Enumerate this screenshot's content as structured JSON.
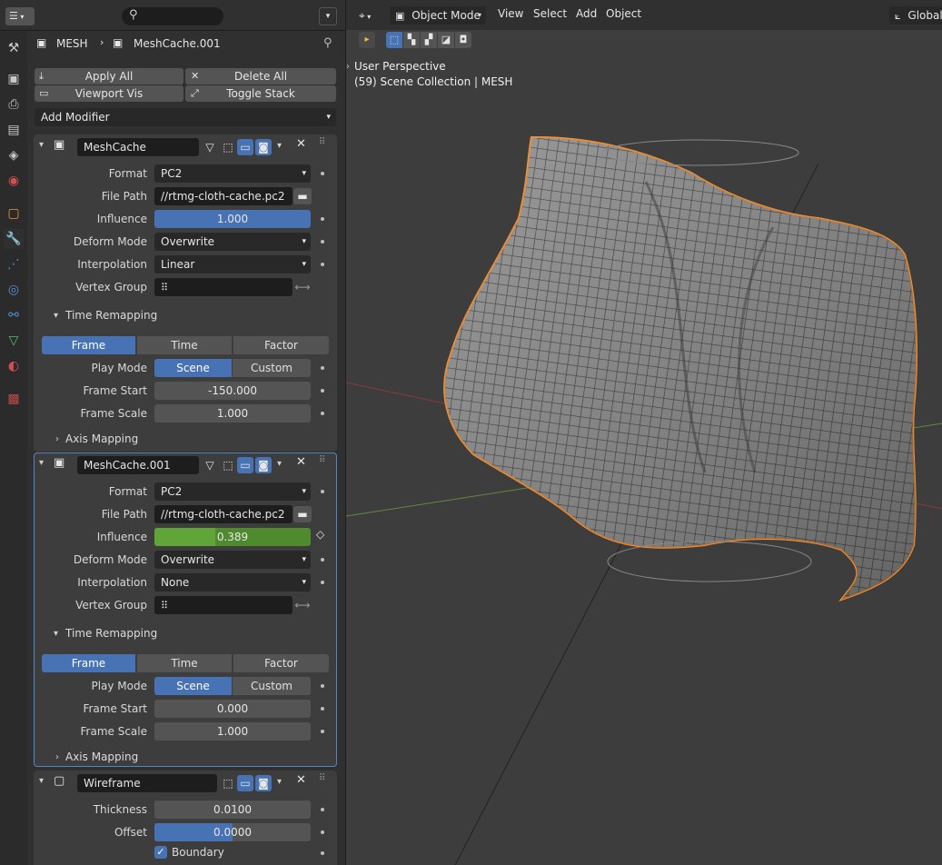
{
  "header": {
    "breadcrumb": {
      "object": "MESH",
      "modifier": "MeshCache.001"
    },
    "search_placeholder": ""
  },
  "toolbar": {
    "apply_all": "Apply All",
    "delete_all": "Delete All",
    "viewport_vis": "Viewport Vis",
    "toggle_stack": "Toggle Stack",
    "add_modifier": "Add Modifier"
  },
  "modifiers": [
    {
      "name": "MeshCache",
      "format_label": "Format",
      "format": "PC2",
      "file_path_label": "File Path",
      "file_path": "//rtmg-cloth-cache.pc2",
      "influence_label": "Influence",
      "influence": "1.000",
      "influence_value": 1.0,
      "deform_mode_label": "Deform Mode",
      "deform_mode": "Overwrite",
      "interpolation_label": "Interpolation",
      "interpolation": "Linear",
      "vertex_group_label": "Vertex Group",
      "time_remapping": "Time Remapping",
      "time_tabs": [
        "Frame",
        "Time",
        "Factor"
      ],
      "play_mode_label": "Play Mode",
      "play_modes": [
        "Scene",
        "Custom"
      ],
      "frame_start_label": "Frame Start",
      "frame_start": "-150.000",
      "frame_scale_label": "Frame Scale",
      "frame_scale": "1.000",
      "axis_mapping": "Axis Mapping"
    },
    {
      "name": "MeshCache.001",
      "format_label": "Format",
      "format": "PC2",
      "file_path_label": "File Path",
      "file_path": "//rtmg-cloth-cache.pc2",
      "influence_label": "Influence",
      "influence": "0.389",
      "influence_value": 0.389,
      "deform_mode_label": "Deform Mode",
      "deform_mode": "Overwrite",
      "interpolation_label": "Interpolation",
      "interpolation": "None",
      "vertex_group_label": "Vertex Group",
      "time_remapping": "Time Remapping",
      "time_tabs": [
        "Frame",
        "Time",
        "Factor"
      ],
      "play_mode_label": "Play Mode",
      "play_modes": [
        "Scene",
        "Custom"
      ],
      "frame_start_label": "Frame Start",
      "frame_start": "0.000",
      "frame_scale_label": "Frame Scale",
      "frame_scale": "1.000",
      "axis_mapping": "Axis Mapping"
    },
    {
      "name": "Wireframe",
      "thickness_label": "Thickness",
      "thickness": "0.0100",
      "offset_label": "Offset",
      "offset": "0.0000",
      "offset_fill": 0.5,
      "boundary_label": "Boundary"
    }
  ],
  "viewport": {
    "mode": "Object Mode",
    "menus": [
      "View",
      "Select",
      "Add",
      "Object"
    ],
    "orientation": "Global",
    "perspective": "User Perspective",
    "collection": "(59) Scene Collection | MESH"
  },
  "colors": {
    "accent": "#4772b3",
    "animated": "#4f8a2f",
    "selection": "#f0913a"
  }
}
